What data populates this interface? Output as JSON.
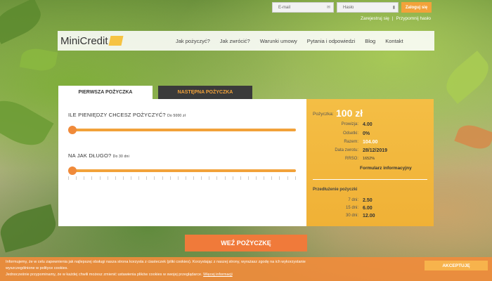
{
  "login": {
    "email_placeholder": "E-mail",
    "password_placeholder": "Hasło",
    "login_button": "Zaloguj się",
    "register_link": "Zarejestruj się",
    "separator": "|",
    "reset_link": "Przypomnij hasło"
  },
  "header": {
    "logo_text": "MiniCredit",
    "nav": [
      "Jak pożyczyć?",
      "Jak zwrócić?",
      "Warunki umowy",
      "Pytania i odpowiedzi",
      "Blog",
      "Kontakt"
    ]
  },
  "tabs": {
    "first_loan": "PIERWSZA POŻYCZKA",
    "next_loan": "NASTĘPNA POŻYCZKA"
  },
  "slider_amount": {
    "question": "ILE PIENIĘDZY CHCESZ POŻYCZYĆ?",
    "hint": "Do 5000 zł",
    "tick_labels": [
      "",
      "",
      "",
      "",
      "",
      "",
      "",
      ""
    ],
    "value_fraction": 0.0
  },
  "slider_days": {
    "question": "NA JAK DŁUGO?",
    "hint": "Do 30 dni",
    "value_fraction": 0.0
  },
  "summary": {
    "amount_label": "Pożyczka:",
    "amount_value": "100 zł",
    "rows": [
      {
        "label": "Prowizja:",
        "value": "4.00"
      },
      {
        "label": "Odsetki:",
        "value": "0%"
      },
      {
        "label": "Razem:",
        "value": "104.00"
      },
      {
        "label": "Data zwrotu:",
        "value": "28/12/2019"
      },
      {
        "label": "RRSO:",
        "value": "1652%"
      }
    ],
    "form_link": "Formularz informacyjny",
    "extension_title": "Przedłużenie pożyczki",
    "extensions": [
      {
        "label": "7 dni:",
        "value": "2.50"
      },
      {
        "label": "15 dni:",
        "value": "6.00"
      },
      {
        "label": "30 dni:",
        "value": "12.00"
      }
    ]
  },
  "cta": "WEŹ POŻYCZKĘ",
  "cookie": {
    "line1": "Informujemy, że w celu zapewnienia jak najlepszej obsługi nasza strona korzysta z ciasteczek (pliki cookies). Korzystając z naszej strony, wyrażasz zgodę na ich wykorzystanie",
    "line2": "wyszczególnione w polityce cookies.",
    "line3": "Jednocześnie przypominamy, że w każdej chwili możesz zmienić ustawienia plików cookies w swojej przeglądarce.",
    "more_link": "Więcej informacji",
    "accept": "AKCEPTUJĘ"
  }
}
